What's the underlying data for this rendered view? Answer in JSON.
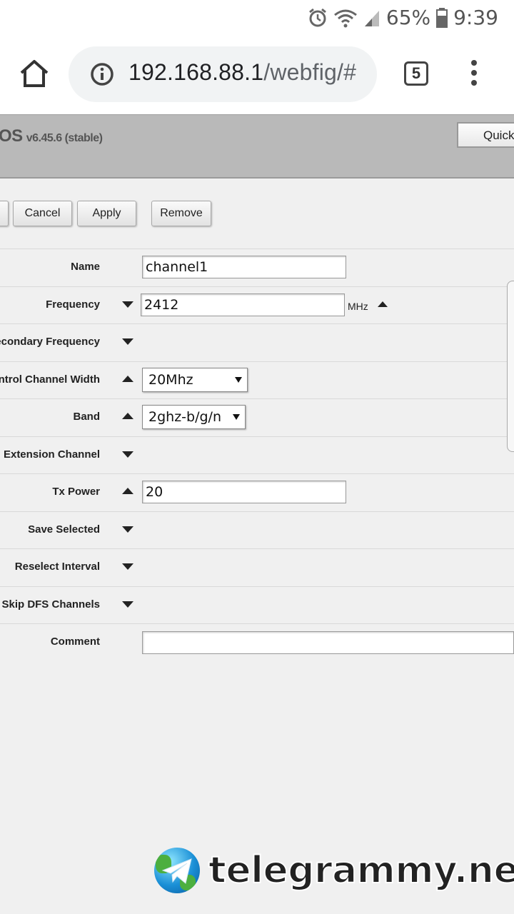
{
  "status_bar": {
    "battery_percent": "65%",
    "time": "9:39",
    "icons": [
      "alarm-icon",
      "wifi-icon",
      "signal-icon",
      "battery-icon"
    ]
  },
  "browser": {
    "url_host": "192.168.88.1",
    "url_path": "/webfig/#",
    "tab_count": "5"
  },
  "webfig": {
    "title_os": "OS",
    "title_version": "v6.45.6 (stable)",
    "quick_button": "Quick"
  },
  "toolbar": {
    "cancel_label": "Cancel",
    "apply_label": "Apply",
    "remove_label": "Remove"
  },
  "form": {
    "name": {
      "label": "Name",
      "value": "channel1"
    },
    "frequency": {
      "label": "Frequency",
      "value": "2412",
      "unit": "MHz"
    },
    "secondary_frequency": {
      "label": "econdary Frequency"
    },
    "control_channel_width": {
      "label": "ntrol Channel Width",
      "value": "20Mhz"
    },
    "band": {
      "label": "Band",
      "value": "2ghz-b/g/n"
    },
    "extension_channel": {
      "label": "Extension Channel"
    },
    "tx_power": {
      "label": "Tx Power",
      "value": "20"
    },
    "save_selected": {
      "label": "Save Selected"
    },
    "reselect_interval": {
      "label": "Reselect Interval"
    },
    "skip_dfs_channels": {
      "label": "Skip DFS Channels"
    },
    "comment": {
      "label": "Comment",
      "value": ""
    }
  },
  "watermark": {
    "text": "telegrammy.net"
  }
}
